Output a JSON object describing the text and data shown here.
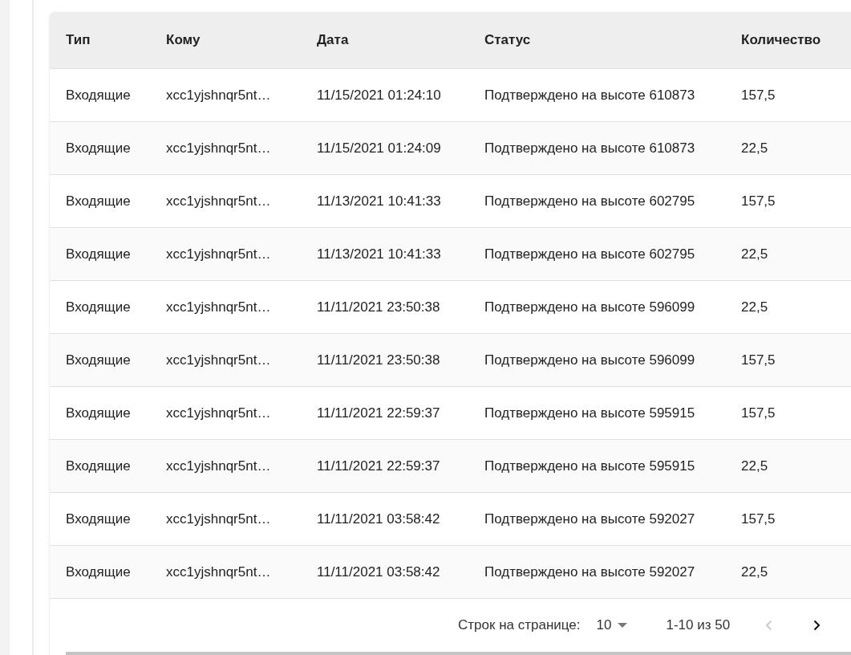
{
  "table": {
    "columns": [
      "Тип",
      "Кому",
      "Дата",
      "Статус",
      "Количество"
    ],
    "rows": [
      [
        "Входящие",
        "xcc1yjshnqr5nt…",
        "11/15/2021 01:24:10",
        "Подтверждено на высоте 610873",
        "157,5"
      ],
      [
        "Входящие",
        "xcc1yjshnqr5nt…",
        "11/15/2021 01:24:09",
        "Подтверждено на высоте 610873",
        "22,5"
      ],
      [
        "Входящие",
        "xcc1yjshnqr5nt…",
        "11/13/2021 10:41:33",
        "Подтверждено на высоте 602795",
        "157,5"
      ],
      [
        "Входящие",
        "xcc1yjshnqr5nt…",
        "11/13/2021 10:41:33",
        "Подтверждено на высоте 602795",
        "22,5"
      ],
      [
        "Входящие",
        "xcc1yjshnqr5nt…",
        "11/11/2021 23:50:38",
        "Подтверждено на высоте 596099",
        "22,5"
      ],
      [
        "Входящие",
        "xcc1yjshnqr5nt…",
        "11/11/2021 23:50:38",
        "Подтверждено на высоте 596099",
        "157,5"
      ],
      [
        "Входящие",
        "xcc1yjshnqr5nt…",
        "11/11/2021 22:59:37",
        "Подтверждено на высоте 595915",
        "157,5"
      ],
      [
        "Входящие",
        "xcc1yjshnqr5nt…",
        "11/11/2021 22:59:37",
        "Подтверждено на высоте 595915",
        "22,5"
      ],
      [
        "Входящие",
        "xcc1yjshnqr5nt…",
        "11/11/2021 03:58:42",
        "Подтверждено на высоте 592027",
        "157,5"
      ],
      [
        "Входящие",
        "xcc1yjshnqr5nt…",
        "11/11/2021 03:58:42",
        "Подтверждено на высоте 592027",
        "22,5"
      ]
    ]
  },
  "pagination": {
    "rows_per_page_label": "Строк на странице:",
    "rows_per_page": "10",
    "range": "1-10 из 50",
    "previous": {
      "disabled": true
    },
    "next": {
      "disabled": false
    }
  }
}
